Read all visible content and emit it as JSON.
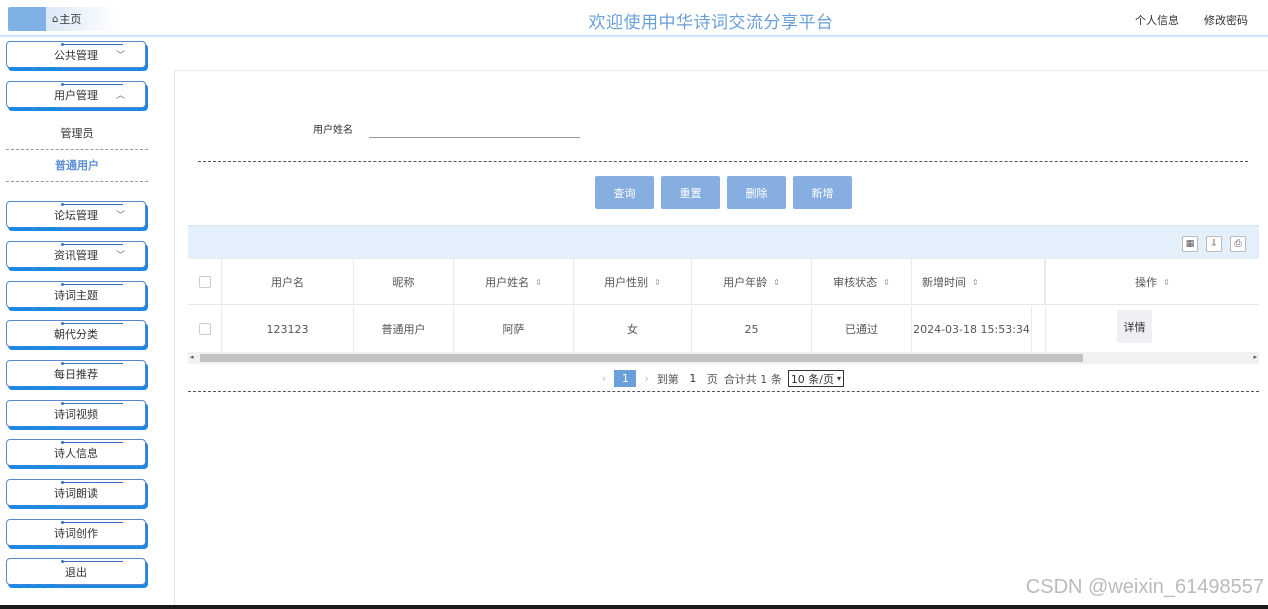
{
  "header": {
    "home_icon": "⌂",
    "home_label": "主页",
    "site_title": "欢迎使用中华诗词交流分享平台",
    "profile_link": "个人信息",
    "password_link": "修改密码"
  },
  "sidebar": {
    "menus": [
      {
        "label": "公共管理",
        "chevron": "﹀"
      },
      {
        "label": "用户管理",
        "chevron": "︿"
      },
      {
        "label": "论坛管理",
        "chevron": "﹀"
      },
      {
        "label": "资讯管理",
        "chevron": "﹀"
      },
      {
        "label": "诗词主题",
        "chevron": ""
      },
      {
        "label": "朝代分类",
        "chevron": ""
      },
      {
        "label": "每日推荐",
        "chevron": ""
      },
      {
        "label": "诗词视频",
        "chevron": ""
      },
      {
        "label": "诗人信息",
        "chevron": ""
      },
      {
        "label": "诗词朗读",
        "chevron": ""
      },
      {
        "label": "诗词创作",
        "chevron": ""
      },
      {
        "label": "退出",
        "chevron": ""
      }
    ],
    "submenu": [
      {
        "label": "管理员",
        "active": false
      },
      {
        "label": "普通用户",
        "active": true
      }
    ]
  },
  "search": {
    "label": "用户姓名",
    "value": "",
    "placeholder": ""
  },
  "actions": {
    "query": "查询",
    "reset": "重置",
    "delete": "删除",
    "add": "新增"
  },
  "toolbar_icons": [
    "columns-icon",
    "export-icon",
    "print-icon"
  ],
  "table": {
    "columns": [
      "用户名",
      "昵称",
      "用户姓名",
      "用户性别",
      "用户年龄",
      "审核状态",
      "新增时间",
      "操作"
    ],
    "rows": [
      {
        "username": "123123",
        "nickname": "普通用户",
        "realname": "阿萨",
        "gender": "女",
        "age": "25",
        "status": "已通过",
        "created": "2024-03-18 15:53:34",
        "action": "详情"
      }
    ]
  },
  "pagination": {
    "prev": "‹",
    "current_page": "1",
    "next": "›",
    "goto_label": "到第",
    "goto_value": "1",
    "page_suffix": "页",
    "total_text": "合计共 1 条",
    "page_size": "10 条/页"
  },
  "watermark": "CSDN @weixin_61498557"
}
